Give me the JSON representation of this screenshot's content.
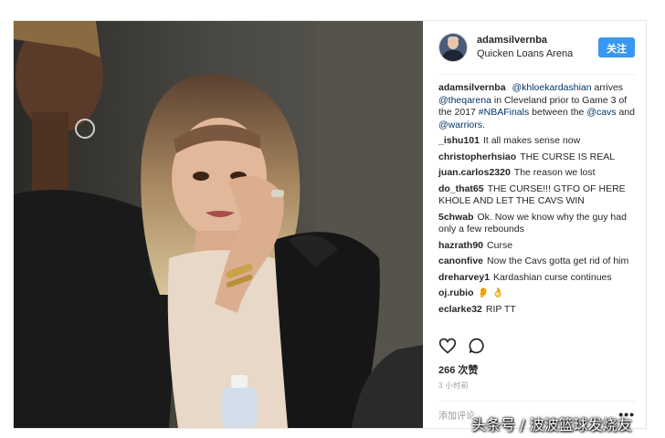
{
  "header": {
    "username": "adamsilvernba",
    "location": "Quicken Loans Arena",
    "follow_label": "关注"
  },
  "caption": {
    "user": "adamsilvernba",
    "mention1": "@khloekardashian",
    "t1": " arrives ",
    "mention2": "@theqarena",
    "t2": " in Cleveland prior to Game 3 of the 2017 ",
    "hashtag": "#NBAFinals",
    "t3": " between the ",
    "mention3": "@cavs",
    "t4": " and ",
    "mention4": "@warriors",
    "t5": "."
  },
  "comments": [
    {
      "user": "_ishu101",
      "text": "It all makes sense now"
    },
    {
      "user": "christopherhsiao",
      "text": "THE CURSE IS REAL"
    },
    {
      "user": "juan.carlos2320",
      "text": "The reason we lost"
    },
    {
      "user": "do_that65",
      "text": "THE CURSE!!! GTFO OF HERE KHOLE AND LET THE CAVS WIN"
    },
    {
      "user": "5chwab",
      "text": "Ok. Now we know why the guy had only a few rebounds"
    },
    {
      "user": "hazrath90",
      "text": "Curse"
    },
    {
      "user": "canonfive",
      "text": "Now the Cavs gotta get rid of him"
    },
    {
      "user": "dreharvey1",
      "text": "Kardashian curse continues"
    },
    {
      "user": "oj.rubio",
      "text": "👂 👌"
    },
    {
      "user": "eclarke32",
      "text": "RIP TT"
    }
  ],
  "likes": "266 次赞",
  "time": "3 小时前",
  "add_comment_placeholder": "添加评论...",
  "more_label": "•••",
  "watermark": "头条号 / 波波篮球发烧友"
}
